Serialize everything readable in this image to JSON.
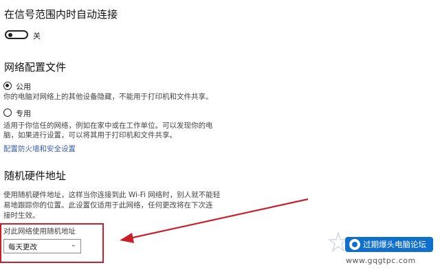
{
  "auto_connect": {
    "heading": "在信号范围内时自动连接",
    "toggle_state_label": "关"
  },
  "network_profile": {
    "heading": "网络配置文件",
    "public": {
      "label": "公用",
      "description": "你的电脑对网络上的其他设备隐藏，不能用于打印机和文件共享。",
      "selected": true
    },
    "private": {
      "label": "专用",
      "description_line1": "适用于你信任的网络，例如在家中或在工作单位。可以发现你的电",
      "description_line2": "脑，如果进行设置，可以将其用于打印机和文件共享。",
      "selected": false
    },
    "firewall_link": "配置防火墙和安全设置"
  },
  "random_hw": {
    "heading": "随机硬件地址",
    "description_line1": "使用随机硬件地址，这样当你连接到此 Wi-Fi 网络时，别人就不能轻",
    "description_line2": "易地跟踪你的位置。此设置仅适用于此网络，任何更改将在下次连",
    "description_line3": "接时生效。",
    "select_label": "对此网络使用随机地址",
    "select_value": "每天更改"
  },
  "watermark": {
    "text": "过期爆头电脑论坛",
    "url": "www.gqgtpc.com"
  },
  "colors": {
    "highlight": "#c8202b",
    "link": "#3a5fb0",
    "watermark_bg": "#0f6fcb"
  },
  "icons": {
    "toggle": "toggle-off-icon",
    "radio_selected": "radio-checked-icon",
    "radio_empty": "radio-unchecked-icon",
    "dropdown": "chevron-down-icon",
    "arrow": "red-arrow-icon"
  }
}
